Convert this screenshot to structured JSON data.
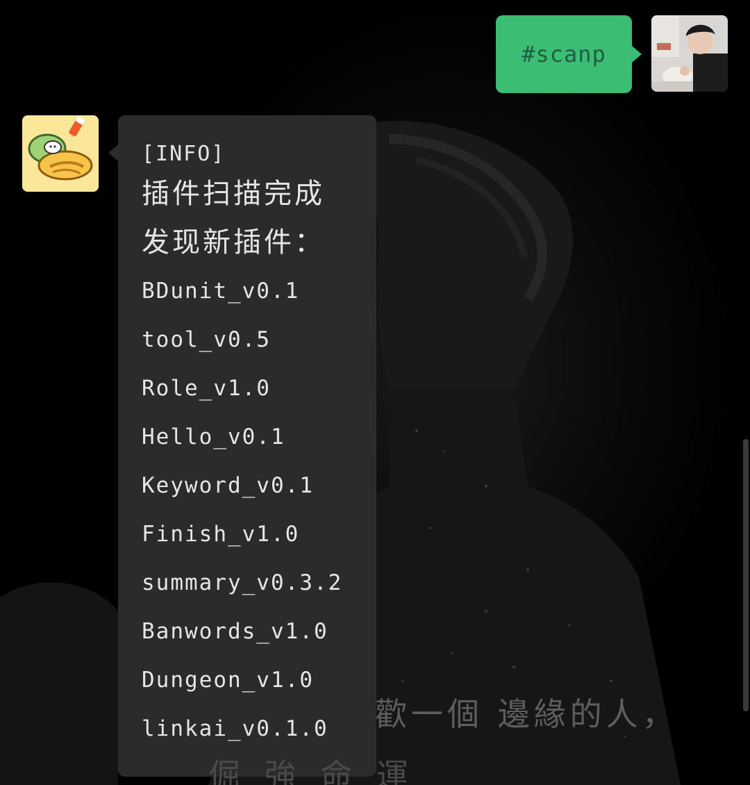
{
  "outgoing_message": {
    "text": "#scanp",
    "bubble_color": "#3bbd73",
    "text_color": "#1f5e44"
  },
  "incoming_message": {
    "tag": "[INFO]",
    "line1": "插件扫描完成",
    "line2": "发现新插件：",
    "plugins": [
      "BDunit_v0.1",
      "tool_v0.5",
      "Role_v1.0",
      "Hello_v0.1",
      "Keyword_v0.1",
      "Finish_v1.0",
      "summary_v0.3.2",
      "Banwords_v1.0",
      "Dungeon_v1.0",
      "linkai_v0.1.0"
    ],
    "bubble_color": "#2b2b2b",
    "text_color": "#e6e6e6"
  },
  "wallpaper": {
    "caption": "歡一個 邊緣的人，",
    "caption_2": "倔 強 命 運"
  },
  "icons": {
    "user_avatar": "user-avatar-photo",
    "bot_avatar": "bot-avatar-cartoon"
  }
}
